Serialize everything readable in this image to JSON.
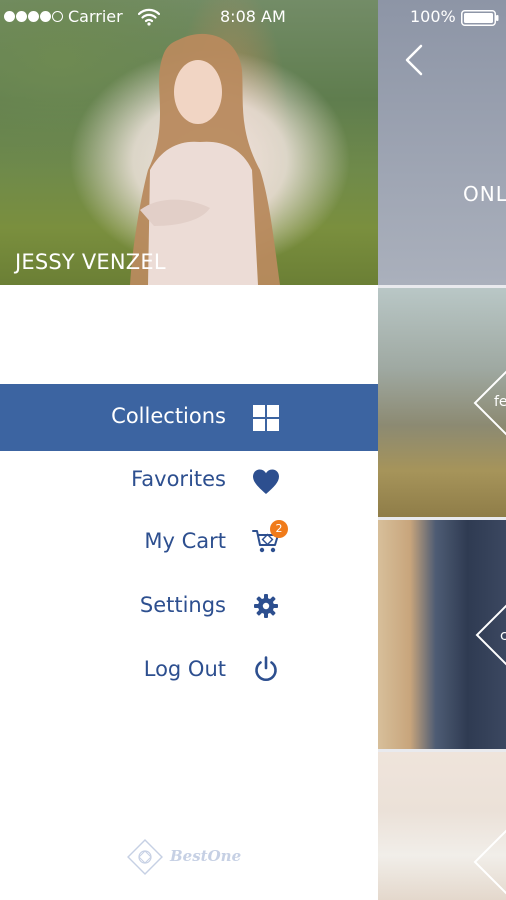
{
  "status_bar": {
    "carrier": "Carrier",
    "time": "8:08 AM",
    "battery": "100%",
    "signal_bars_filled": 4,
    "signal_bars_total": 5
  },
  "profile": {
    "name": "JESSY VENZEL"
  },
  "menu": {
    "items": [
      {
        "label": "Collections",
        "icon": "grid-icon",
        "active": true
      },
      {
        "label": "Favorites",
        "icon": "heart-icon",
        "active": false
      },
      {
        "label": "My Cart",
        "icon": "cart-icon",
        "active": false,
        "badge": "2"
      },
      {
        "label": "Settings",
        "icon": "gear-icon",
        "active": false
      },
      {
        "label": "Log Out",
        "icon": "power-icon",
        "active": false
      }
    ]
  },
  "brand": {
    "name": "BestOne"
  },
  "content": {
    "header_text": "ONL",
    "tiles": [
      {
        "label": "fe"
      },
      {
        "label": "c"
      },
      {
        "label": ""
      }
    ]
  },
  "colors": {
    "accent": "#3c64a1",
    "menu_text": "#2d4f8f",
    "badge": "#f07b1a",
    "brand_logo": "#c6d0e4"
  }
}
